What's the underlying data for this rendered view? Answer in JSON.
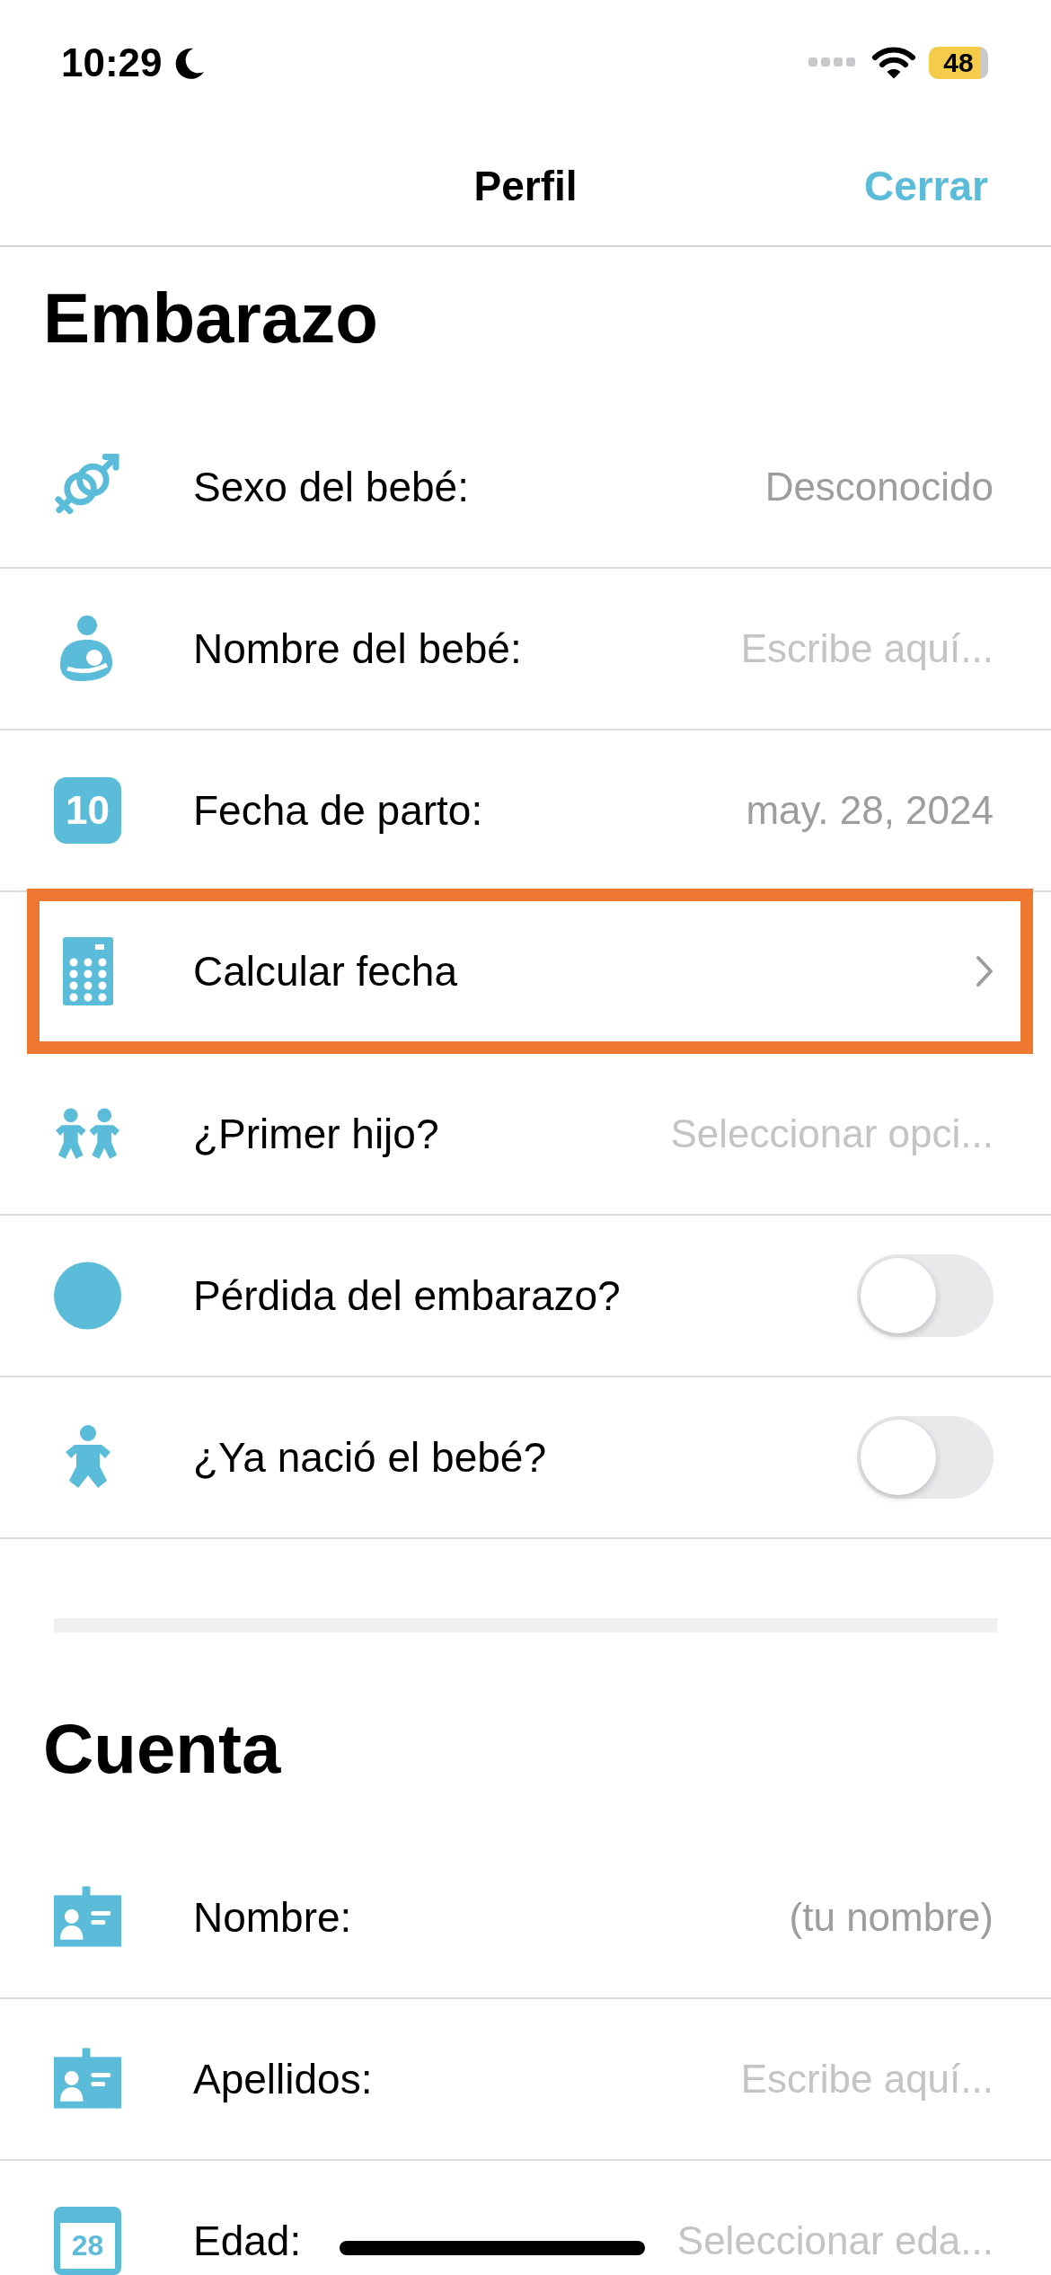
{
  "status_bar": {
    "time": "10:29",
    "battery": "48"
  },
  "nav": {
    "title": "Perfil",
    "close": "Cerrar"
  },
  "sections": [
    {
      "title": "Embarazo",
      "rows": [
        {
          "label": "Sexo del bebé:",
          "kind": "value",
          "value": "Desconocido",
          "highlighted": false
        },
        {
          "label": "Nombre del bebé:",
          "kind": "placeholder",
          "value": "Escribe aquí...",
          "highlighted": false
        },
        {
          "icon_label": "10",
          "label": "Fecha de parto:",
          "kind": "value",
          "value": "may. 28, 2024",
          "highlighted": false
        },
        {
          "label": "Calcular fecha",
          "kind": "link",
          "highlighted": true
        },
        {
          "label": "¿Primer hijo?",
          "kind": "placeholder",
          "value": "Seleccionar opci...",
          "highlighted": false
        },
        {
          "label": "Pérdida del embarazo?",
          "kind": "toggle",
          "on": false,
          "highlighted": false
        },
        {
          "label": "¿Ya nació el bebé?",
          "kind": "toggle",
          "on": false,
          "highlighted": false
        }
      ]
    },
    {
      "title": "Cuenta",
      "rows": [
        {
          "label": "Nombre:",
          "kind": "value",
          "value": "(tu nombre)",
          "highlighted": false
        },
        {
          "label": "Apellidos:",
          "kind": "placeholder",
          "value": "Escribe aquí...",
          "highlighted": false
        },
        {
          "icon_label": "28",
          "label": "Edad:",
          "kind": "placeholder",
          "value": "Seleccionar eda...",
          "highlighted": false
        }
      ]
    }
  ]
}
